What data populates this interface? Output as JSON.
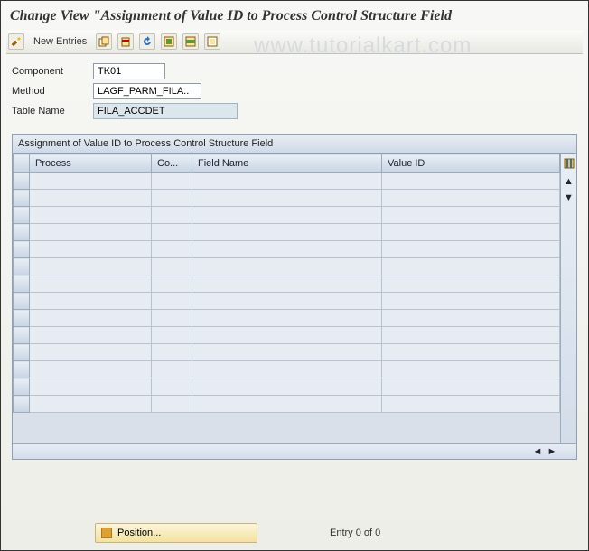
{
  "title": "Change View \"Assignment of Value ID to Process Control Structure Field",
  "watermark": "www.tutorialkart.com",
  "toolbar": {
    "new_entries": "New Entries",
    "icons": [
      "toggle",
      "copy",
      "delete",
      "undo",
      "select-all",
      "select-block",
      "deselect-all"
    ]
  },
  "form": {
    "component": {
      "label": "Component",
      "value": "TK01"
    },
    "method": {
      "label": "Method",
      "value": "LAGF_PARM_FILA.."
    },
    "table_name": {
      "label": "Table Name",
      "value": "FILA_ACCDET"
    }
  },
  "grid": {
    "title": "Assignment of Value ID to Process Control Structure Field",
    "columns": [
      "Process",
      "Co...",
      "Field Name",
      "Value ID"
    ],
    "rows": [
      [
        "",
        "",
        "",
        ""
      ],
      [
        "",
        "",
        "",
        ""
      ],
      [
        "",
        "",
        "",
        ""
      ],
      [
        "",
        "",
        "",
        ""
      ],
      [
        "",
        "",
        "",
        ""
      ],
      [
        "",
        "",
        "",
        ""
      ],
      [
        "",
        "",
        "",
        ""
      ],
      [
        "",
        "",
        "",
        ""
      ],
      [
        "",
        "",
        "",
        ""
      ],
      [
        "",
        "",
        "",
        ""
      ],
      [
        "",
        "",
        "",
        ""
      ],
      [
        "",
        "",
        "",
        ""
      ],
      [
        "",
        "",
        "",
        ""
      ],
      [
        "",
        "",
        "",
        ""
      ]
    ]
  },
  "footer": {
    "position_label": "Position...",
    "entry_text": "Entry 0 of 0"
  }
}
